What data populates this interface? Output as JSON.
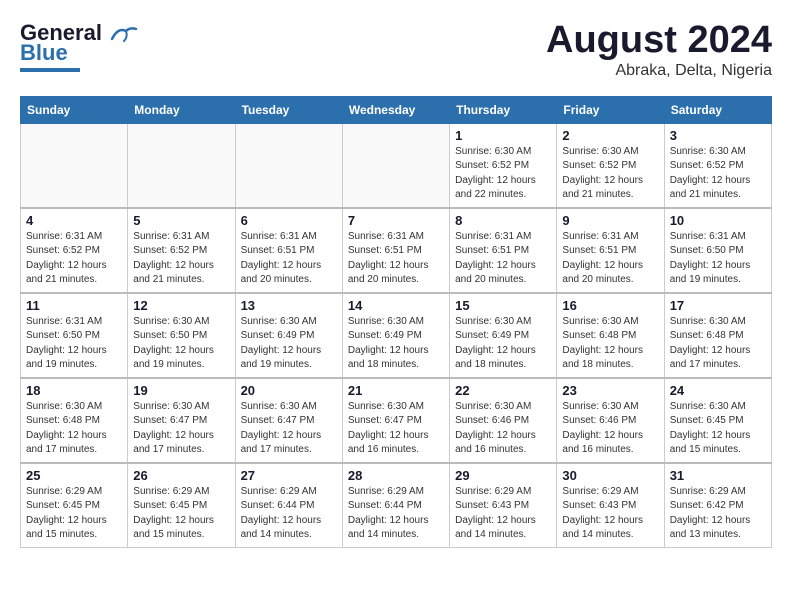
{
  "header": {
    "logo_line1": "General",
    "logo_line2": "Blue",
    "main_title": "August 2024",
    "subtitle": "Abraka, Delta, Nigeria"
  },
  "calendar": {
    "days_of_week": [
      "Sunday",
      "Monday",
      "Tuesday",
      "Wednesday",
      "Thursday",
      "Friday",
      "Saturday"
    ],
    "weeks": [
      [
        {
          "day": "",
          "info": ""
        },
        {
          "day": "",
          "info": ""
        },
        {
          "day": "",
          "info": ""
        },
        {
          "day": "",
          "info": ""
        },
        {
          "day": "1",
          "info": "Sunrise: 6:30 AM\nSunset: 6:52 PM\nDaylight: 12 hours\nand 22 minutes."
        },
        {
          "day": "2",
          "info": "Sunrise: 6:30 AM\nSunset: 6:52 PM\nDaylight: 12 hours\nand 21 minutes."
        },
        {
          "day": "3",
          "info": "Sunrise: 6:30 AM\nSunset: 6:52 PM\nDaylight: 12 hours\nand 21 minutes."
        }
      ],
      [
        {
          "day": "4",
          "info": "Sunrise: 6:31 AM\nSunset: 6:52 PM\nDaylight: 12 hours\nand 21 minutes."
        },
        {
          "day": "5",
          "info": "Sunrise: 6:31 AM\nSunset: 6:52 PM\nDaylight: 12 hours\nand 21 minutes."
        },
        {
          "day": "6",
          "info": "Sunrise: 6:31 AM\nSunset: 6:51 PM\nDaylight: 12 hours\nand 20 minutes."
        },
        {
          "day": "7",
          "info": "Sunrise: 6:31 AM\nSunset: 6:51 PM\nDaylight: 12 hours\nand 20 minutes."
        },
        {
          "day": "8",
          "info": "Sunrise: 6:31 AM\nSunset: 6:51 PM\nDaylight: 12 hours\nand 20 minutes."
        },
        {
          "day": "9",
          "info": "Sunrise: 6:31 AM\nSunset: 6:51 PM\nDaylight: 12 hours\nand 20 minutes."
        },
        {
          "day": "10",
          "info": "Sunrise: 6:31 AM\nSunset: 6:50 PM\nDaylight: 12 hours\nand 19 minutes."
        }
      ],
      [
        {
          "day": "11",
          "info": "Sunrise: 6:31 AM\nSunset: 6:50 PM\nDaylight: 12 hours\nand 19 minutes."
        },
        {
          "day": "12",
          "info": "Sunrise: 6:30 AM\nSunset: 6:50 PM\nDaylight: 12 hours\nand 19 minutes."
        },
        {
          "day": "13",
          "info": "Sunrise: 6:30 AM\nSunset: 6:49 PM\nDaylight: 12 hours\nand 19 minutes."
        },
        {
          "day": "14",
          "info": "Sunrise: 6:30 AM\nSunset: 6:49 PM\nDaylight: 12 hours\nand 18 minutes."
        },
        {
          "day": "15",
          "info": "Sunrise: 6:30 AM\nSunset: 6:49 PM\nDaylight: 12 hours\nand 18 minutes."
        },
        {
          "day": "16",
          "info": "Sunrise: 6:30 AM\nSunset: 6:48 PM\nDaylight: 12 hours\nand 18 minutes."
        },
        {
          "day": "17",
          "info": "Sunrise: 6:30 AM\nSunset: 6:48 PM\nDaylight: 12 hours\nand 17 minutes."
        }
      ],
      [
        {
          "day": "18",
          "info": "Sunrise: 6:30 AM\nSunset: 6:48 PM\nDaylight: 12 hours\nand 17 minutes."
        },
        {
          "day": "19",
          "info": "Sunrise: 6:30 AM\nSunset: 6:47 PM\nDaylight: 12 hours\nand 17 minutes."
        },
        {
          "day": "20",
          "info": "Sunrise: 6:30 AM\nSunset: 6:47 PM\nDaylight: 12 hours\nand 17 minutes."
        },
        {
          "day": "21",
          "info": "Sunrise: 6:30 AM\nSunset: 6:47 PM\nDaylight: 12 hours\nand 16 minutes."
        },
        {
          "day": "22",
          "info": "Sunrise: 6:30 AM\nSunset: 6:46 PM\nDaylight: 12 hours\nand 16 minutes."
        },
        {
          "day": "23",
          "info": "Sunrise: 6:30 AM\nSunset: 6:46 PM\nDaylight: 12 hours\nand 16 minutes."
        },
        {
          "day": "24",
          "info": "Sunrise: 6:30 AM\nSunset: 6:45 PM\nDaylight: 12 hours\nand 15 minutes."
        }
      ],
      [
        {
          "day": "25",
          "info": "Sunrise: 6:29 AM\nSunset: 6:45 PM\nDaylight: 12 hours\nand 15 minutes."
        },
        {
          "day": "26",
          "info": "Sunrise: 6:29 AM\nSunset: 6:45 PM\nDaylight: 12 hours\nand 15 minutes."
        },
        {
          "day": "27",
          "info": "Sunrise: 6:29 AM\nSunset: 6:44 PM\nDaylight: 12 hours\nand 14 minutes."
        },
        {
          "day": "28",
          "info": "Sunrise: 6:29 AM\nSunset: 6:44 PM\nDaylight: 12 hours\nand 14 minutes."
        },
        {
          "day": "29",
          "info": "Sunrise: 6:29 AM\nSunset: 6:43 PM\nDaylight: 12 hours\nand 14 minutes."
        },
        {
          "day": "30",
          "info": "Sunrise: 6:29 AM\nSunset: 6:43 PM\nDaylight: 12 hours\nand 14 minutes."
        },
        {
          "day": "31",
          "info": "Sunrise: 6:29 AM\nSunset: 6:42 PM\nDaylight: 12 hours\nand 13 minutes."
        }
      ]
    ]
  }
}
